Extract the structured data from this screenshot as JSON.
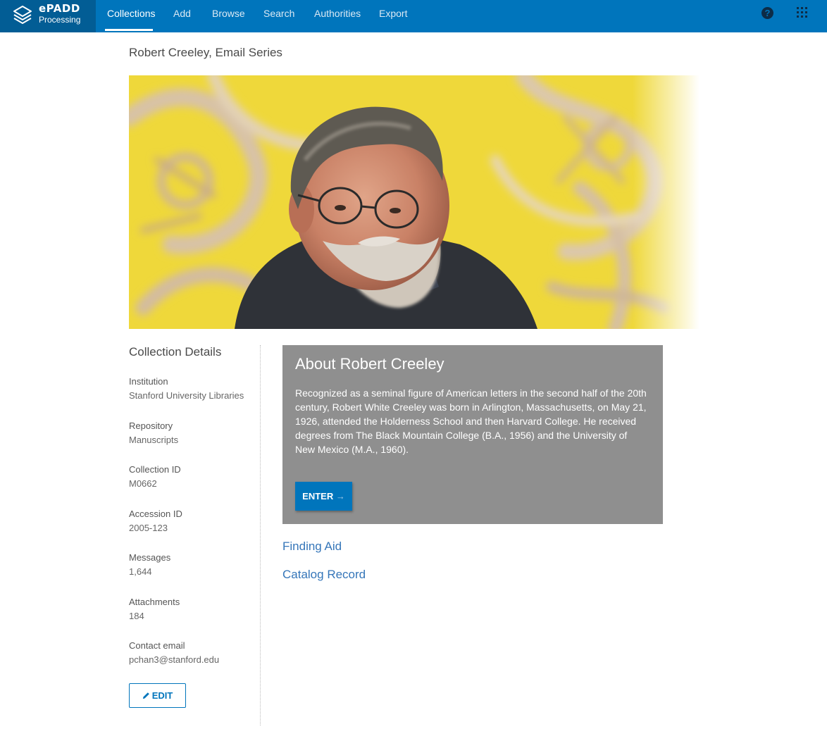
{
  "app": {
    "logo_word": "ePADD",
    "logo_sub": "Processing",
    "logo_icon": "stacked-layers-icon"
  },
  "nav": {
    "items": [
      "Collections",
      "Add",
      "Browse",
      "Search",
      "Authorities",
      "Export"
    ],
    "active": "Collections",
    "help_icon": "question-circle-icon",
    "help_glyph": "?",
    "apps_icon": "grid-apps-icon"
  },
  "page": {
    "title": "Robert Creeley, Email Series"
  },
  "details": {
    "title": "Collection Details",
    "fields": [
      {
        "label": "Institution",
        "value": "Stanford University Libraries"
      },
      {
        "label": "Repository",
        "value": "Manuscripts"
      },
      {
        "label": "Collection ID",
        "value": "M0662"
      },
      {
        "label": "Accession ID",
        "value": "2005-123"
      },
      {
        "label": "Messages",
        "value": "1,644"
      },
      {
        "label": "Attachments",
        "value": "184"
      },
      {
        "label": "Contact email",
        "value": "pchan3@stanford.edu"
      }
    ],
    "edit_label": "EDIT",
    "edit_icon": "pencil-icon"
  },
  "about": {
    "title": "About Robert Creeley",
    "text": "Recognized as a seminal figure of American letters in the second half of the 20th century, Robert White Creeley was born in Arlington, Massachusetts, on May 21, 1926, attended the Holderness School and then Harvard College. He received degrees from The Black Mountain College (B.A., 1956) and the University of New Mexico (M.A., 1960).",
    "enter_label": "ENTER",
    "enter_arrow": "→"
  },
  "links": {
    "finding_aid": "Finding Aid",
    "catalog_record": "Catalog Record"
  },
  "colors": {
    "nav_bg": "#0075bc",
    "logo_bg": "#025d95",
    "about_bg": "#8f8f8f",
    "link": "#3576b9",
    "hero_yellow": "#f1dd3a"
  }
}
